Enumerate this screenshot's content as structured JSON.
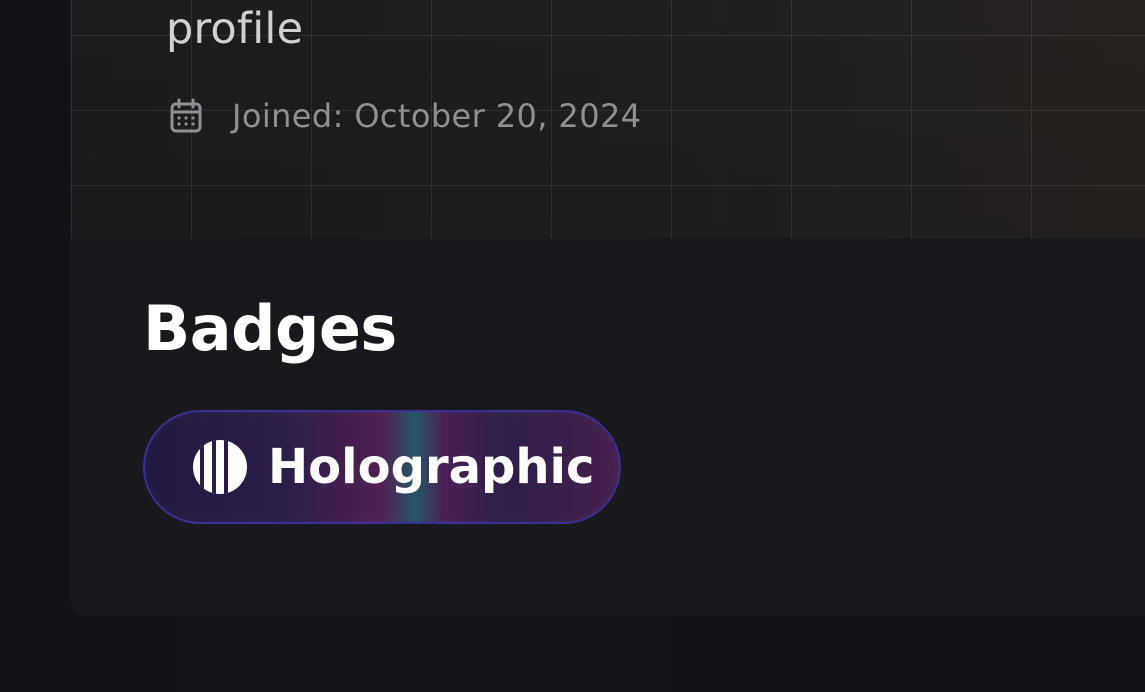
{
  "profile": {
    "heading_fragment": "profile",
    "joined_text": "Joined: October 20, 2024",
    "joined_icon": "calendar-icon"
  },
  "badges": {
    "title": "Badges",
    "items": [
      {
        "label": "Holographic",
        "icon": "holographic-bars-icon",
        "colors": {
          "border": "#3a2f92",
          "background_start": "#21183f",
          "background_mid": "#521f54",
          "background_highlight": "#235766",
          "background_end": "#47204f",
          "text": "#ffffff"
        }
      }
    ]
  },
  "colors": {
    "page_background": "#111116",
    "card_background": "#18181d",
    "hero_background": "#1f1f21",
    "primary_text": "#ffffff",
    "secondary_text": "#8f8f94"
  }
}
